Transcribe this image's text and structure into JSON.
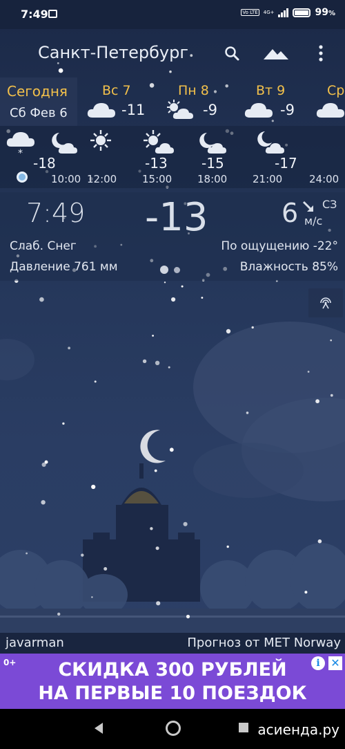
{
  "status_bar": {
    "time": "7:49",
    "battery": "99",
    "battery_unit": "%",
    "volte": "Vo LTE",
    "network": "4G+"
  },
  "header": {
    "city": "Санкт-Петербург"
  },
  "days": [
    {
      "label": "Сегодня",
      "date": "Сб Фев 6"
    },
    {
      "label": "Вс 7",
      "temp": "-11",
      "icon": "cloud-icon"
    },
    {
      "label": "Пн 8",
      "temp": "-9",
      "icon": "sun-cloud-icon"
    },
    {
      "label": "Вт 9",
      "temp": "-9",
      "icon": "cloud-icon"
    },
    {
      "label": "Ср",
      "icon": "cloud-icon"
    }
  ],
  "hourly": [
    {
      "temp": "-18",
      "time": "",
      "icon": "snow-cloud-icon"
    },
    {
      "temp": "",
      "time": "10:00",
      "icon": "moon-cloud-icon"
    },
    {
      "temp": "",
      "time": "12:00",
      "icon": "sun-icon"
    },
    {
      "temp": "-13",
      "time": "15:00",
      "icon": "sun-cloud-icon"
    },
    {
      "temp": "-15",
      "time": "18:00",
      "icon": "moon-cloud-icon"
    },
    {
      "temp": "-17",
      "time": "21:00",
      "icon": "moon-cloud-icon"
    },
    {
      "temp": "",
      "time": "24:00",
      "icon": ""
    }
  ],
  "current": {
    "time": "7:49",
    "temp": "-13",
    "wind_speed": "6",
    "wind_dir": "СЗ",
    "wind_unit": "м/с",
    "condition": "Слаб. Снег",
    "feels_like": "По ощущению -22°",
    "pressure": "Давление 761 мм",
    "humidity": "Влажность 85%"
  },
  "footer": {
    "author": "javarman",
    "source": "Прогноз от MET Norway"
  },
  "ad": {
    "logo": "0+",
    "line1": "СКИДКА 300 РУБЛЕЙ",
    "line2": "НА ПЕРВЫЕ 10 ПОЕЗДОК",
    "info": "i",
    "close": "✕"
  },
  "watermark": "асиенда.ру",
  "colors": {
    "accent": "#f2c04b",
    "ad_bg": "#7b4ad6",
    "sky": "#243659"
  }
}
